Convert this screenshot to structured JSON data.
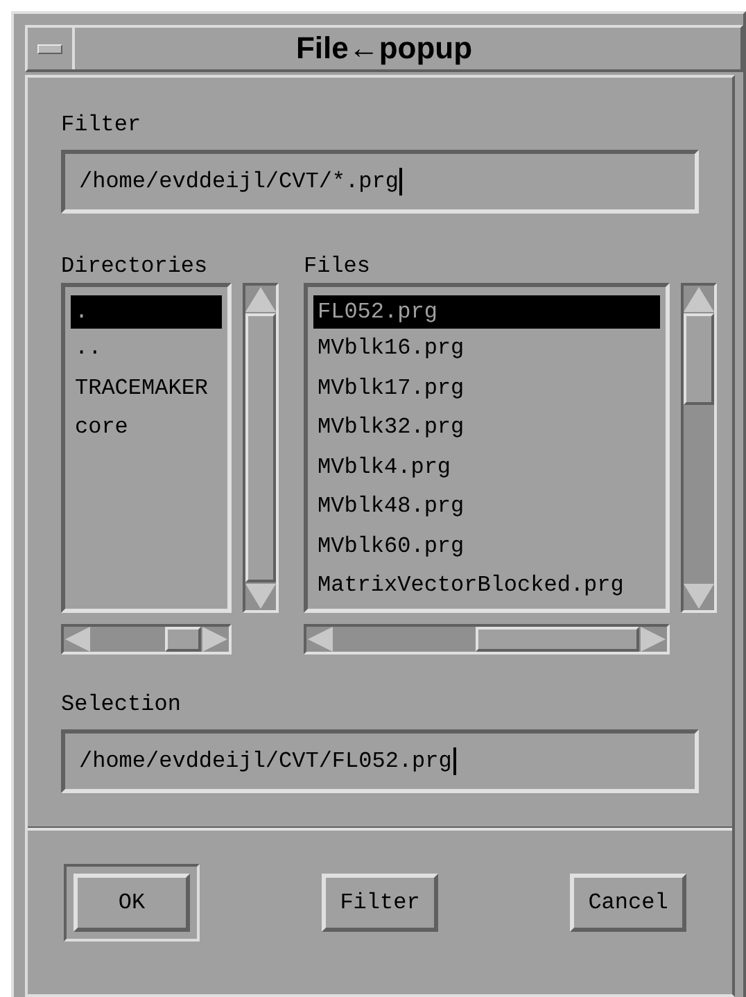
{
  "window": {
    "title": "File←popup"
  },
  "filter": {
    "label": "Filter",
    "value": "/home/evddeijl/CVT/*.prg"
  },
  "directories": {
    "label": "Directories",
    "items": [
      {
        "label": ".",
        "selected": true
      },
      {
        "label": "..",
        "selected": false
      },
      {
        "label": "TRACEMAKER",
        "selected": false
      },
      {
        "label": "core",
        "selected": false
      }
    ]
  },
  "files": {
    "label": "Files",
    "items": [
      {
        "label": "FL052.prg",
        "selected": true
      },
      {
        "label": "MVblk16.prg",
        "selected": false
      },
      {
        "label": "MVblk17.prg",
        "selected": false
      },
      {
        "label": "MVblk32.prg",
        "selected": false
      },
      {
        "label": "MVblk4.prg",
        "selected": false
      },
      {
        "label": "MVblk48.prg",
        "selected": false
      },
      {
        "label": "MVblk60.prg",
        "selected": false
      },
      {
        "label": "MatrixVectorBlocked.prg",
        "selected": false
      }
    ]
  },
  "selection": {
    "label": "Selection",
    "value": "/home/evddeijl/CVT/FL052.prg"
  },
  "buttons": [
    {
      "label": "OK",
      "default": true
    },
    {
      "label": "Filter",
      "default": false
    },
    {
      "label": "Cancel",
      "default": false
    }
  ]
}
